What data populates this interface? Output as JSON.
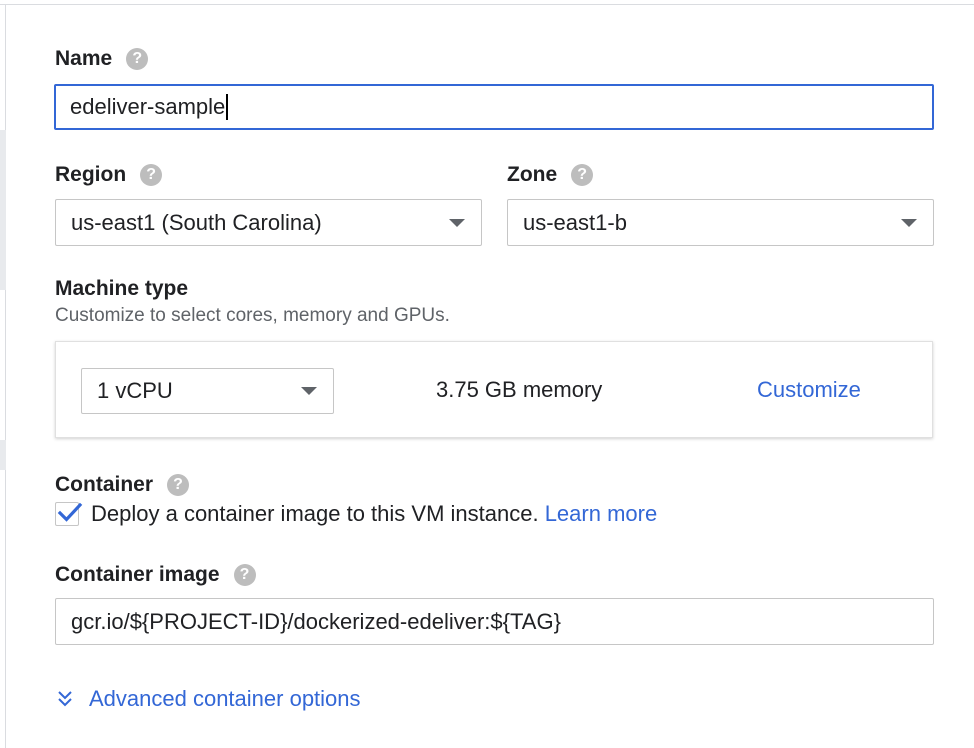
{
  "name": {
    "label": "Name",
    "value": "edeliver-sample"
  },
  "region": {
    "label": "Region",
    "value": "us-east1 (South Carolina)"
  },
  "zone": {
    "label": "Zone",
    "value": "us-east1-b"
  },
  "machine_type": {
    "label": "Machine type",
    "description": "Customize to select cores, memory and GPUs.",
    "cpu_value": "1 vCPU",
    "memory_text": "3.75 GB memory",
    "customize_label": "Customize"
  },
  "container": {
    "label": "Container",
    "checked": true,
    "checkbox_text": "Deploy a container image to this VM instance.",
    "learn_more_label": "Learn more"
  },
  "container_image": {
    "label": "Container image",
    "value": "gcr.io/${PROJECT-ID}/dockerized-edeliver:${TAG}"
  },
  "advanced": {
    "label": "Advanced container options"
  },
  "icons": {
    "help": "help-icon",
    "dropdown": "dropdown-arrow-icon",
    "check": "checkmark-icon",
    "expand": "double-chevron-down-icon"
  },
  "colors": {
    "accent": "#3367d6",
    "help_icon": "#bdbdbd",
    "text": "#202124",
    "secondary_text": "#5f6368"
  }
}
